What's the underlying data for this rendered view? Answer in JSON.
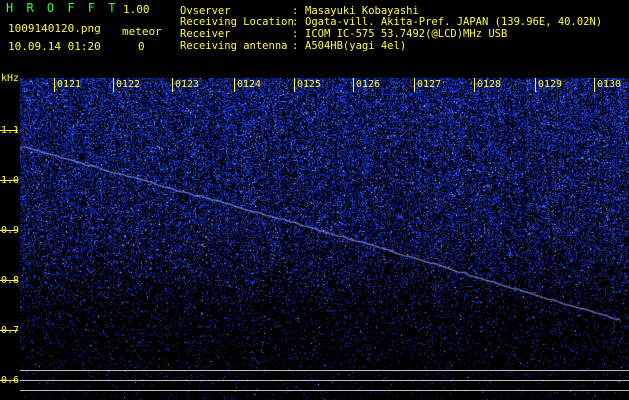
{
  "app": {
    "name": "H R O F F T",
    "version": "1.00"
  },
  "file": {
    "name": "1009140120.png",
    "datetime": "10.09.14 01:20"
  },
  "meteor": {
    "label": "meteor",
    "count": "0"
  },
  "info": [
    {
      "key": "Ovserver",
      "sep": ":",
      "value": "Masayuki Kobayashi"
    },
    {
      "key": "Receiving Location",
      "sep": ":",
      "value": "Ogata-vill. Akita-Pref. JAPAN (139.96E, 40.02N)"
    },
    {
      "key": "Receiver",
      "sep": ":",
      "value": "ICOM IC-575 53.7492(@LCD)MHz USB"
    },
    {
      "key": "Receiving antenna",
      "sep": ":",
      "value": "A504HB(yagi 4el)"
    }
  ],
  "yaxis": {
    "unit": "kHz",
    "ticks": [
      "1.1",
      "1.0",
      "0.9",
      "0.8",
      "0.7",
      "0.6"
    ]
  },
  "xaxis": {
    "ticks": [
      "0121",
      "0122",
      "0123",
      "0124",
      "0125",
      "0126",
      "0127",
      "0128",
      "0129",
      "0130"
    ]
  },
  "colors": {
    "label": "#ffff33",
    "title": "#33ff33",
    "noise": "#3344ff",
    "trail": "#8899ff"
  }
}
